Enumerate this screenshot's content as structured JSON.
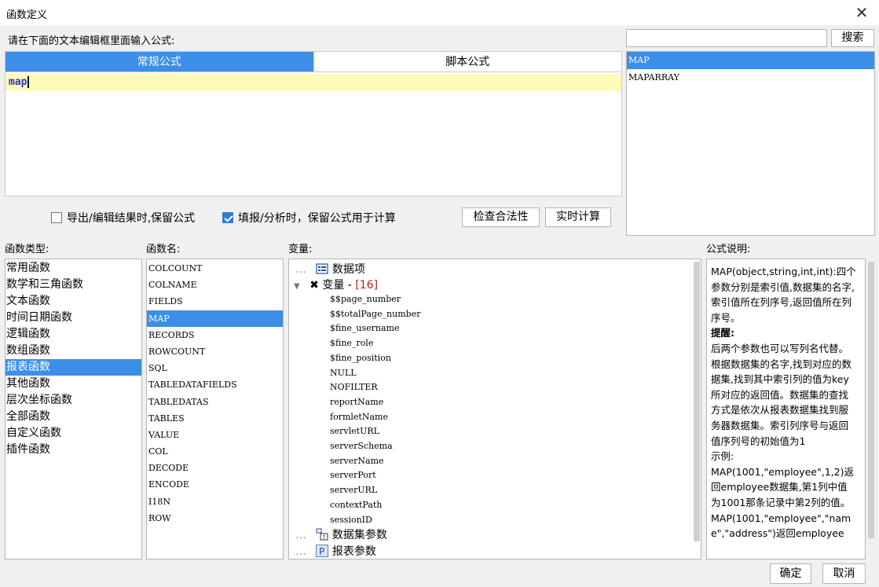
{
  "window": {
    "title": "函数定义",
    "close_label": "✕"
  },
  "prompt": "请在下面的文本编辑框里面输入公式:",
  "tabs": [
    {
      "label": "常规公式",
      "active": true
    },
    {
      "label": "脚本公式",
      "active": false
    }
  ],
  "editor": {
    "content": "map"
  },
  "search": {
    "value": "",
    "button_label": "搜索"
  },
  "matches": [
    {
      "label": "MAP",
      "selected": true
    },
    {
      "label": "MAPARRAY",
      "selected": false
    }
  ],
  "options": {
    "keep_formula_export": {
      "label": "导出/编辑结果时,保留公式",
      "checked": false
    },
    "keep_formula_fill": {
      "label": "填报/分析时，保留公式用于计算",
      "checked": true
    }
  },
  "buttons": {
    "check_validity": "检查合法性",
    "realtime_calc": "实时计算",
    "ok": "确定",
    "cancel": "取消"
  },
  "labels": {
    "function_types": "函数类型:",
    "function_names": "函数名:",
    "variables": "变量:",
    "formula_description": "公式说明:"
  },
  "function_types": [
    "常用函数",
    "数学和三角函数",
    "文本函数",
    "时间日期函数",
    "逻辑函数",
    "数组函数",
    "报表函数",
    "其他函数",
    "层次坐标函数",
    "全部函数",
    "自定义函数",
    "插件函数"
  ],
  "selected_type_index": 6,
  "function_names": [
    "COLCOUNT",
    "COLNAME",
    "FIELDS",
    "MAP",
    "RECORDS",
    "ROWCOUNT",
    "SQL",
    "TABLEDATAFIELDS",
    "TABLEDATAS",
    "TABLES",
    "VALUE",
    "COL",
    "DECODE",
    "ENCODE",
    "I18N",
    "ROW"
  ],
  "selected_function_index": 3,
  "variables": {
    "data_item": "数据项",
    "var_group_label": "变量 - ",
    "var_group_count": "[16]",
    "var_items": [
      "$$page_number",
      "$$totalPage_number",
      "$fine_username",
      "$fine_role",
      "$fine_position",
      "NULL",
      "NOFILTER",
      "reportName",
      "formletName",
      "servletURL",
      "serverSchema",
      "serverName",
      "serverPort",
      "serverURL",
      "contextPath",
      "sessionID"
    ],
    "dataset_params": "数据集参数",
    "report_params": "报表参数"
  },
  "description": "MAP(object,string,int,int):四个参数分别是索引值,数据集的名字,索引值所在列序号,返回值所在列序号。\n提醒:\n后两个参数也可以写列名代替。根据数据集的名字,找到对应的数据集,找到其中索引列的值为key所对应的返回值。数据集的查找方式是依次从报表数据集找到服务器数据集。索引列序号与返回值序列号的初始值为1\n示例:\nMAP(1001,\"employee\",1,2)返回employee数据集,第1列中值为1001那条记录中第2列的值。\nMAP(1001,\"employee\",\"name\",\"address\")返回employee"
}
